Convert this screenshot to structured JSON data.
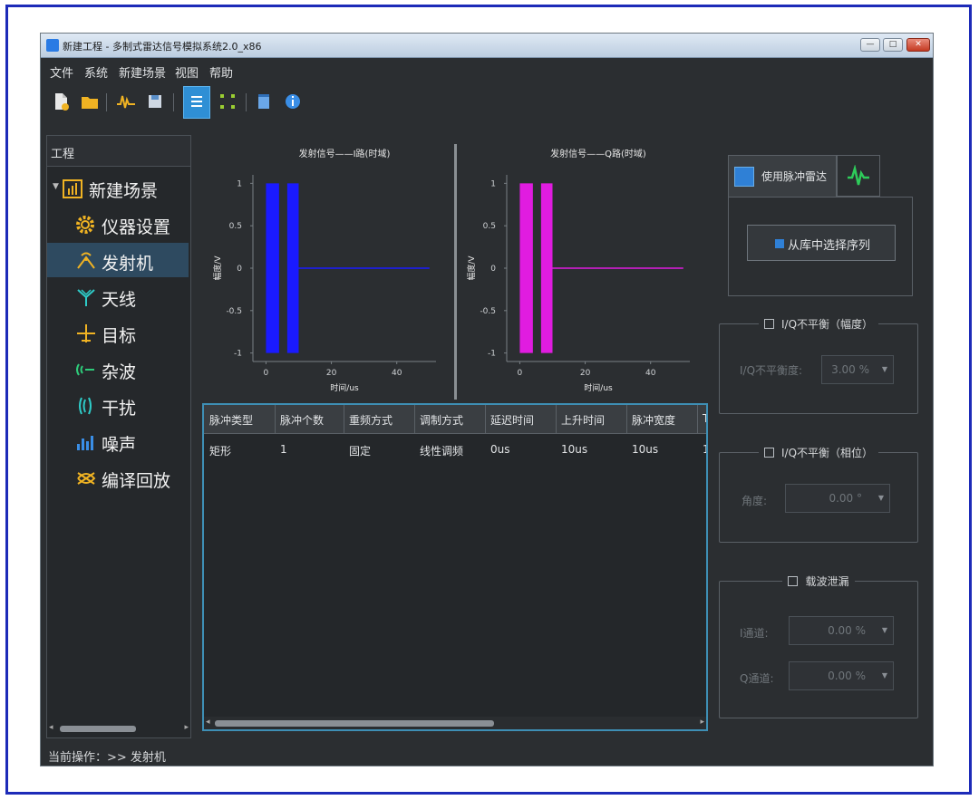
{
  "window": {
    "title": "新建工程 - 多制式雷达信号模拟系统2.0_x86",
    "minimize_glyph": "—",
    "maximize_glyph": "□",
    "close_glyph": "✕"
  },
  "menu": [
    "文件",
    "系统",
    "新建场景",
    "视图",
    "帮助"
  ],
  "toolbar": {
    "icons": [
      "new-file-icon",
      "open-folder-icon",
      "waveform-icon",
      "save-icon",
      "list-view-icon",
      "grid-view-icon",
      "document-icon",
      "info-icon"
    ],
    "active": "list-view-icon"
  },
  "sidebar": {
    "header": "工程",
    "root": {
      "label": "新建场景",
      "icon": "scene-chart-icon"
    },
    "items": [
      {
        "label": "仪器设置",
        "icon": "gear-icon"
      },
      {
        "label": "发射机",
        "icon": "transmitter-icon",
        "selected": true
      },
      {
        "label": "天线",
        "icon": "antenna-icon"
      },
      {
        "label": "目标",
        "icon": "aircraft-icon"
      },
      {
        "label": "杂波",
        "icon": "clutter-icon"
      },
      {
        "label": "干扰",
        "icon": "jamming-icon"
      },
      {
        "label": "噪声",
        "icon": "noise-icon"
      },
      {
        "label": "编译回放",
        "icon": "replay-icon"
      }
    ]
  },
  "chart_data": [
    {
      "type": "line",
      "title": "发射信号——I路(时域)",
      "xlabel": "时间/us",
      "ylabel": "幅度/V",
      "xlim": [
        -4,
        52
      ],
      "ylim": [
        -1.1,
        1.1
      ],
      "xticks": [
        "0",
        "20",
        "40"
      ],
      "yticks": [
        "1",
        "0.5",
        "0",
        "-0.5",
        "-1"
      ],
      "color": "#1a1aff",
      "pulse_bands": [
        [
          0,
          4
        ],
        [
          6.5,
          10
        ]
      ],
      "tail": [
        [
          10,
          0
        ],
        [
          50,
          0
        ]
      ]
    },
    {
      "type": "line",
      "title": "发射信号——Q路(时域)",
      "xlabel": "时间/us",
      "ylabel": "幅度/V",
      "xlim": [
        -4,
        52
      ],
      "ylim": [
        -1.1,
        1.1
      ],
      "xticks": [
        "0",
        "20",
        "40"
      ],
      "yticks": [
        "1",
        "0.5",
        "0",
        "-0.5",
        "-1"
      ],
      "color": "#e01ce0",
      "pulse_bands": [
        [
          0,
          4
        ],
        [
          6.5,
          10
        ]
      ],
      "tail": [
        [
          10,
          0
        ],
        [
          50,
          0
        ]
      ]
    }
  ],
  "table": {
    "columns": [
      "脉冲类型",
      "脉冲个数",
      "重频方式",
      "调制方式",
      "延迟时间",
      "上升时间",
      "脉冲宽度",
      "T"
    ],
    "rows": [
      [
        "矩形",
        "1",
        "固定",
        "线性调频",
        "0us",
        "10us",
        "10us",
        "1"
      ]
    ]
  },
  "tabs": [
    {
      "label": "使用脉冲雷达",
      "icon": "radar-pulse-icon",
      "active": true
    },
    {
      "label": "",
      "icon": "green-wave-icon",
      "active": false
    }
  ],
  "library_button": "从库中选择序列",
  "groups": {
    "amp": {
      "title": "I/Q不平衡（幅度）",
      "field_label": "I/Q不平衡度:",
      "value": "3.00 %"
    },
    "phase": {
      "title": "I/Q不平衡（相位）",
      "field_label": "角度:",
      "value": "0.00 °"
    },
    "carrier": {
      "title": "载波泄漏",
      "fields": [
        {
          "label": "I通道:",
          "value": "0.00 %"
        },
        {
          "label": "Q通道:",
          "value": "0.00 %"
        }
      ]
    }
  },
  "status": "当前操作：>> 发射机",
  "colors": {
    "frame_border": "#1d2bb8",
    "app_bg": "#2b2e31",
    "accent": "#2f8fd5",
    "grid_border": "#3e8fb5"
  }
}
